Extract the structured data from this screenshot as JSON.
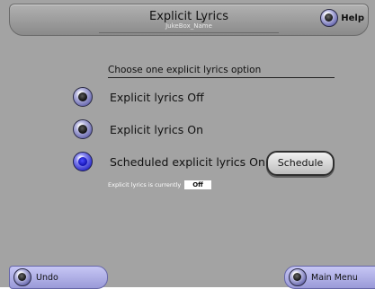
{
  "header": {
    "title": "Explicit Lyrics",
    "subtitle": "JukeBox_Name",
    "help_label": "Help"
  },
  "section": {
    "heading": "Choose one explicit lyrics option"
  },
  "options": [
    {
      "label": "Explicit lyrics Off",
      "selected": false
    },
    {
      "label": "Explicit lyrics On",
      "selected": false
    },
    {
      "label": "Scheduled explicit lyrics On",
      "selected": true
    }
  ],
  "schedule_button": "Schedule",
  "status": {
    "text": "Explicit lyrics is currently",
    "value": "Off"
  },
  "footer": {
    "undo_label": "Undo",
    "main_menu_label": "Main Menu"
  },
  "colors": {
    "background": "#a3a3a3",
    "accent": "#2222c8",
    "button_fill": "#c6c6f4"
  }
}
